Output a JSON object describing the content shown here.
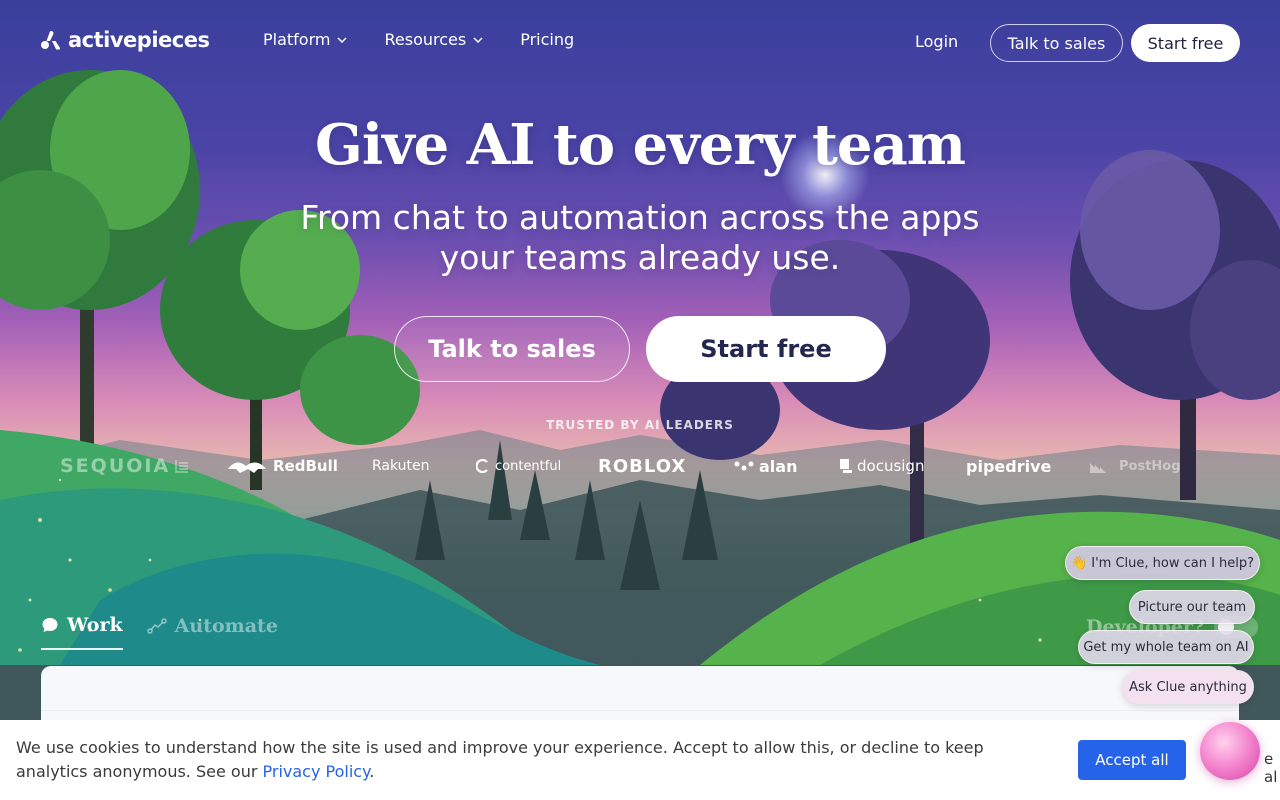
{
  "brand": {
    "name": "activepieces"
  },
  "nav": {
    "items": [
      {
        "label": "Platform",
        "has_dropdown": true
      },
      {
        "label": "Resources",
        "has_dropdown": true
      },
      {
        "label": "Pricing",
        "has_dropdown": false
      }
    ],
    "login": "Login",
    "talk_to_sales": "Talk to sales",
    "start_free": "Start free"
  },
  "hero": {
    "title": "Give AI to every team",
    "subtitle": "From chat to automation across the apps your teams already use.",
    "cta_secondary": "Talk to sales",
    "cta_primary": "Start free"
  },
  "trusted": {
    "heading": "TRUSTED BY AI LEADERS",
    "logos": [
      "SEQUOIA",
      "RedBull",
      "Rakuten",
      "contentful",
      "ROBLOX",
      "alan",
      "docusign",
      "pipedrive",
      "PostHog"
    ]
  },
  "tabs": [
    {
      "label": "Work",
      "active": true,
      "icon": "chat-bubble-icon"
    },
    {
      "label": "Automate",
      "active": false,
      "icon": "workflow-icon"
    }
  ],
  "developer_toggle": {
    "label": "Developer?"
  },
  "chat": {
    "greeting": "👋 I'm Clue, how can I help?",
    "suggestions": [
      "Picture our team",
      "Get my whole team on AI"
    ],
    "ask": "Ask Clue anything"
  },
  "cookie": {
    "text_before": "We use cookies to understand how the site is used and improve your experience. Accept to allow this, or decline to keep analytics anonymous. See our ",
    "link": "Privacy Policy",
    "text_after": ".",
    "accept": "Accept all",
    "cut_off": "e al"
  },
  "colors": {
    "accent_blue": "#2563eb",
    "sky_top": "#3a3f9c",
    "sky_pink": "#d88bb7"
  }
}
